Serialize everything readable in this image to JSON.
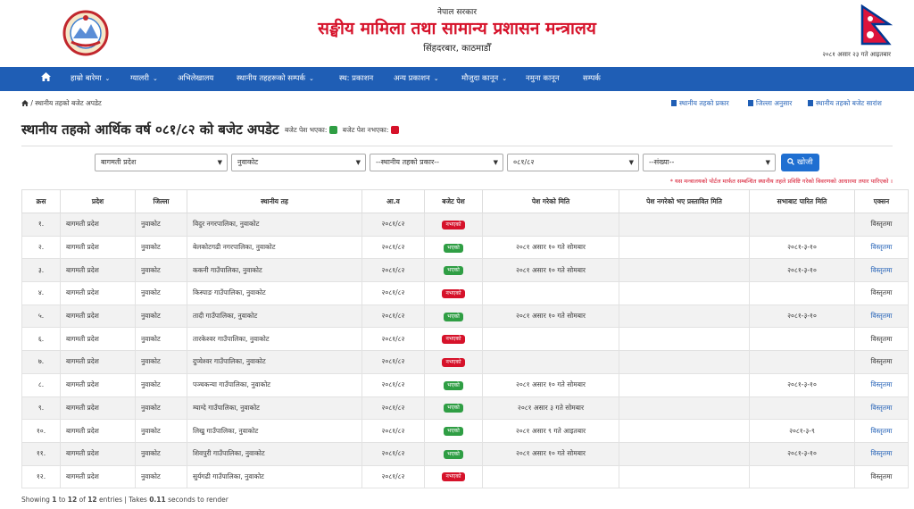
{
  "header": {
    "gov": "नेपाल सरकार",
    "ministry": "सङ्घीय मामिला तथा सामान्य प्रशासन मन्त्रालय",
    "place": "सिंहदरबार, काठमाडौँ",
    "date": "२०८१ असार २३ गते आइतबार"
  },
  "nav": [
    {
      "label": "",
      "icon": "home-icon"
    },
    {
      "label": "हाम्रो बारेमा",
      "dropdown": true
    },
    {
      "label": "ग्यालरी",
      "dropdown": true
    },
    {
      "label": "अभिलेखालय"
    },
    {
      "label": "स्थानीय तहहरूको सम्पर्क",
      "dropdown": true
    },
    {
      "label": "स्थ: प्रकाशन"
    },
    {
      "label": "अन्य प्रकाशन",
      "dropdown": true
    },
    {
      "label": "मौजुदा कानून",
      "dropdown": true
    },
    {
      "label": "नमुना कानून"
    },
    {
      "label": "सम्पर्क"
    }
  ],
  "breadcrumb": "/ स्थानीय तहको बजेट अपडेट",
  "quick_links": [
    "स्थानीय तहको प्रकार",
    "जिल्ला अनुसार",
    "स्थानीय तहको बजेट सारांश"
  ],
  "page_title": "स्थानीय तहको आर्थिक वर्ष ०८१/८२ को बजेट अपडेट",
  "legend": {
    "submitted": "बजेट पेश भएका:",
    "not_submitted": "बजेट पेश नभएका:"
  },
  "filters": {
    "province": "बागमती प्रदेश",
    "district": "नुवाकोट",
    "local_type": "--स्थानीय तहको प्रकार--",
    "fiscal_year": "०८१/८२",
    "count": "--संख्या--",
    "search_label": "खोजी"
  },
  "note": "* यस मन्त्रालयको पोर्टल मार्फत सम्बन्धित स्थानीय तहले प्रविष्टि गरेको विवरणको आधारमा तयार पारिएको ।",
  "table": {
    "headers": [
      "क्रस",
      "प्रदेश",
      "जिल्ला",
      "स्थानीय तह",
      "आ.व",
      "बजेट पेश",
      "पेश गरेको मिति",
      "पेश नगरेको भए प्रस्तावित मिति",
      "सभाबाट पारित मिति",
      "एक्सन"
    ],
    "rows": [
      {
        "sn": "१.",
        "province": "बागमती प्रदेश",
        "district": "नुवाकोट",
        "local": "विदुर नगरपालिका, नुवाकोट",
        "fy": "२०८१/८२",
        "status": "नभएको",
        "submitted": false,
        "sub_date": "",
        "proposed": "",
        "passed": "",
        "action": "विस्तृतमा"
      },
      {
        "sn": "२.",
        "province": "बागमती प्रदेश",
        "district": "नुवाकोट",
        "local": "बेलकोटगढी नगरपालिका, नुवाकोट",
        "fy": "२०८१/८२",
        "status": "भएको",
        "submitted": true,
        "sub_date": "२०८१ असार १० गते सोमबार",
        "proposed": "",
        "passed": "२०८१-३-१०",
        "action": "विस्तृतमा"
      },
      {
        "sn": "३.",
        "province": "बागमती प्रदेश",
        "district": "नुवाकोट",
        "local": "ककनी गाउँपालिका, नुवाकोट",
        "fy": "२०८१/८२",
        "status": "भएको",
        "submitted": true,
        "sub_date": "२०८१ असार १० गते सोमबार",
        "proposed": "",
        "passed": "२०८१-३-१०",
        "action": "विस्तृतमा"
      },
      {
        "sn": "४.",
        "province": "बागमती प्रदेश",
        "district": "नुवाकोट",
        "local": "किस्पाङ गाउँपालिका, नुवाकोट",
        "fy": "२०८१/८२",
        "status": "नभएको",
        "submitted": false,
        "sub_date": "",
        "proposed": "",
        "passed": "",
        "action": "विस्तृतमा"
      },
      {
        "sn": "५.",
        "province": "बागमती प्रदेश",
        "district": "नुवाकोट",
        "local": "तादी गाउँपालिका, नुवाकोट",
        "fy": "२०८१/८२",
        "status": "भएको",
        "submitted": true,
        "sub_date": "२०८१ असार १० गते सोमबार",
        "proposed": "",
        "passed": "२०८१-३-१०",
        "action": "विस्तृतमा"
      },
      {
        "sn": "६.",
        "province": "बागमती प्रदेश",
        "district": "नुवाकोट",
        "local": "तारकेश्वर गाउँपालिका, नुवाकोट",
        "fy": "२०८१/८२",
        "status": "नभएको",
        "submitted": false,
        "sub_date": "",
        "proposed": "",
        "passed": "",
        "action": "विस्तृतमा"
      },
      {
        "sn": "७.",
        "province": "बागमती प्रदेश",
        "district": "नुवाकोट",
        "local": "दुप्चेश्वर गाउँपालिका, नुवाकोट",
        "fy": "२०८१/८२",
        "status": "नभएको",
        "submitted": false,
        "sub_date": "",
        "proposed": "",
        "passed": "",
        "action": "विस्तृतमा"
      },
      {
        "sn": "८.",
        "province": "बागमती प्रदेश",
        "district": "नुवाकोट",
        "local": "पञ्चकन्या गाउँपालिका, नुवाकोट",
        "fy": "२०८१/८२",
        "status": "भएको",
        "submitted": true,
        "sub_date": "२०८१ असार १० गते सोमबार",
        "proposed": "",
        "passed": "२०८१-३-१०",
        "action": "विस्तृतमा"
      },
      {
        "sn": "९.",
        "province": "बागमती प्रदेश",
        "district": "नुवाकोट",
        "local": "म्याग्दे गाउँपालिका, नुवाकोट",
        "fy": "२०८१/८२",
        "status": "भएको",
        "submitted": true,
        "sub_date": "२०८१ असार ३ गते सोमबार",
        "proposed": "",
        "passed": "",
        "action": "विस्तृतमा"
      },
      {
        "sn": "१०.",
        "province": "बागमती प्रदेश",
        "district": "नुवाकोट",
        "local": "लिखु गाउँपालिका, नुवाकोट",
        "fy": "२०८१/८२",
        "status": "भएको",
        "submitted": true,
        "sub_date": "२०८१ असार ९ गते आइतबार",
        "proposed": "",
        "passed": "२०८१-३-९",
        "action": "विस्तृतमा"
      },
      {
        "sn": "११.",
        "province": "बागमती प्रदेश",
        "district": "नुवाकोट",
        "local": "शिवपुरी गाउँपालिका, नुवाकोट",
        "fy": "२०८१/८२",
        "status": "भएको",
        "submitted": true,
        "sub_date": "२०८१ असार १० गते सोमबार",
        "proposed": "",
        "passed": "२०८१-३-१०",
        "action": "विस्तृतमा"
      },
      {
        "sn": "१२.",
        "province": "बागमती प्रदेश",
        "district": "नुवाकोट",
        "local": "सुर्यगढी गाउँपालिका, नुवाकोट",
        "fy": "२०८१/८२",
        "status": "नभएको",
        "submitted": false,
        "sub_date": "",
        "proposed": "",
        "passed": "",
        "action": "विस्तृतमा"
      }
    ]
  },
  "footer": {
    "pre": "Showing ",
    "from": "1",
    "to_word": " to ",
    "to": "12",
    "of_word": " of ",
    "total": "12",
    "mid": " entries | Takes ",
    "time": "0.11",
    "post": " seconds to render"
  },
  "colors": {
    "nav": "#1f5eb5",
    "title_red": "#d6122a",
    "badge_green": "#2f9e44",
    "badge_red": "#d6122a"
  }
}
